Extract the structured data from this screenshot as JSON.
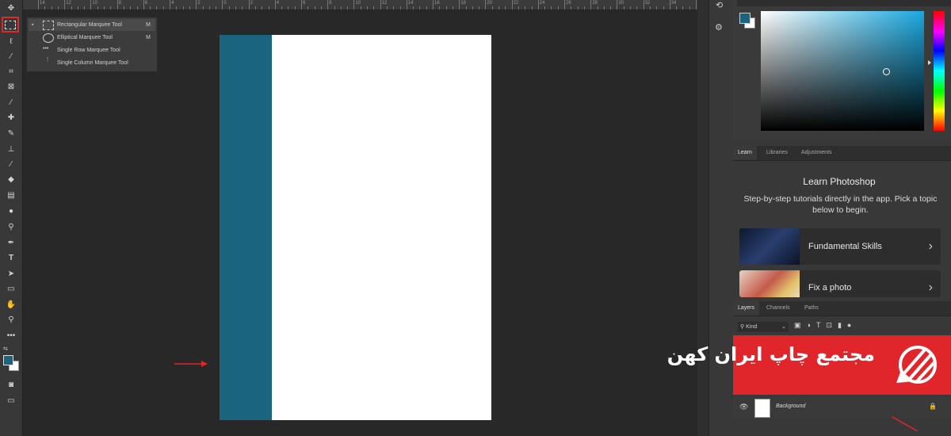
{
  "ruler": {
    "numbers": [
      "14",
      "12",
      "10",
      "8",
      "6",
      "4",
      "2",
      "0",
      "2",
      "4",
      "6",
      "8",
      "10",
      "12",
      "14",
      "16",
      "18",
      "20",
      "22",
      "24",
      "26",
      "28",
      "30",
      "32",
      "34",
      "36"
    ]
  },
  "flyout": {
    "items": [
      {
        "label": "Rectangular Marquee Tool",
        "key": "M"
      },
      {
        "label": "Elliptical Marquee Tool",
        "key": "M"
      },
      {
        "label": "Single Row Marquee Tool",
        "key": ""
      },
      {
        "label": "Single Column Marquee Tool",
        "key": ""
      }
    ]
  },
  "colors": {
    "foreground": "#1b6480",
    "document_band": "#1b6480",
    "document_bg": "#ffffff",
    "accent_red": "#e0262b",
    "selection_outline": "#d92b2b"
  },
  "learn_panel": {
    "tabs": [
      "Learn",
      "Libraries",
      "Adjustments"
    ],
    "title": "Learn Photoshop",
    "description": "Step-by-step tutorials directly in the app. Pick a topic below to begin.",
    "cards": [
      {
        "label": "Fundamental Skills",
        "icon": "chevron-right-icon"
      },
      {
        "label": "Fix a photo",
        "icon": "chevron-right-icon"
      }
    ]
  },
  "layers_panel": {
    "tabs": [
      "Layers",
      "Channels",
      "Paths"
    ],
    "filter_label": "Kind",
    "layer": {
      "name": "Background"
    }
  },
  "banner": {
    "text": "مجتمع چاپ ایران کهن"
  }
}
